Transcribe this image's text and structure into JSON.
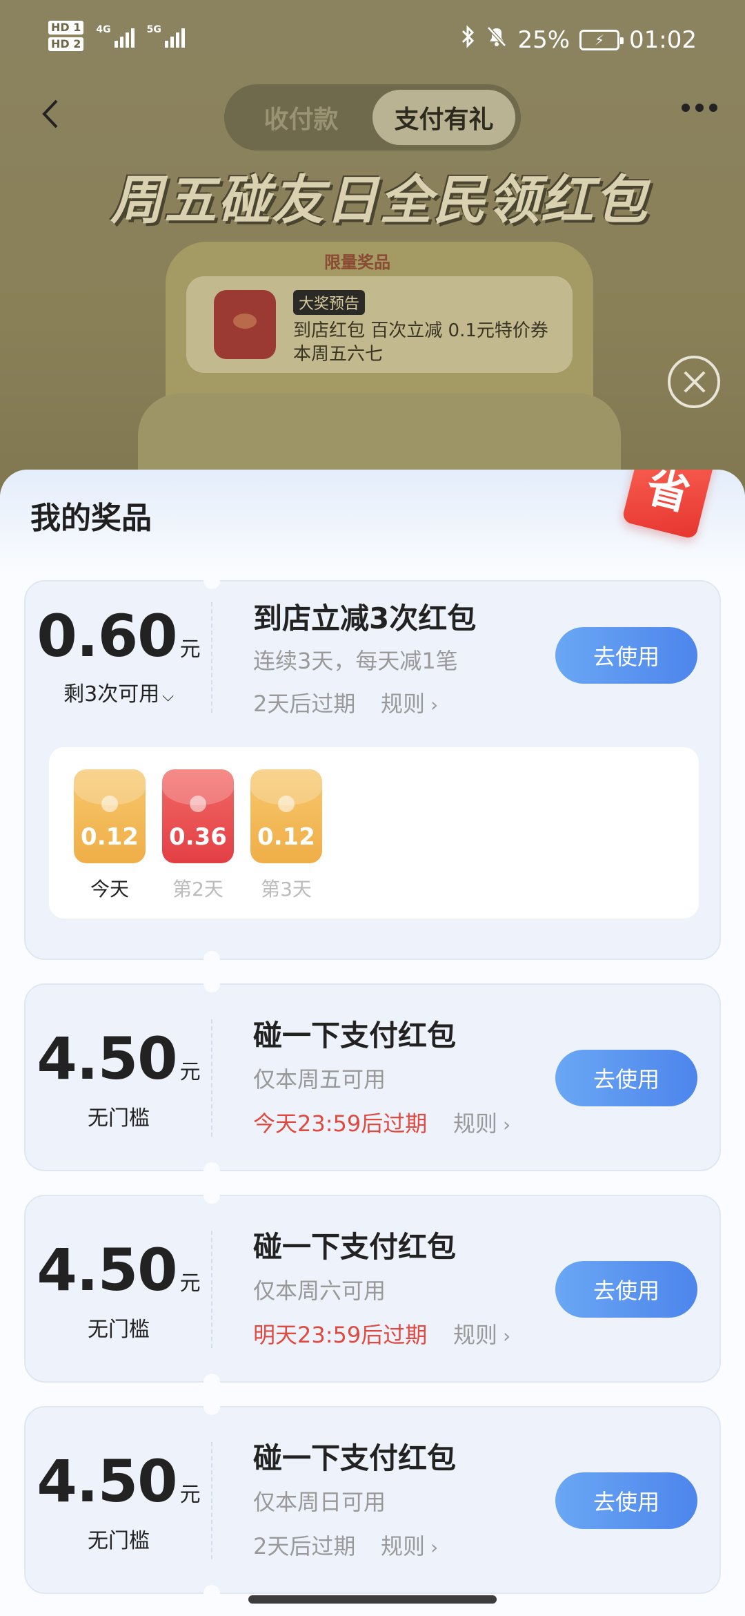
{
  "status_bar": {
    "hd1": "HD 1",
    "hd2": "HD 2",
    "net1": "4G",
    "net2": "5G",
    "battery_pct": "25%",
    "time": "01:02"
  },
  "nav": {
    "tabs": [
      {
        "label": "收付款",
        "active": false
      },
      {
        "label": "支付有礼",
        "active": true
      }
    ]
  },
  "banner": {
    "title": "周五碰友日全民领红包",
    "limit_tag": "限量奖品",
    "badge": "大奖预告",
    "prize_line1": "到店红包 百次立减 0.1元特价券",
    "prize_line2": "本周五六七"
  },
  "sheet": {
    "title": "我的奖品",
    "tag": "省"
  },
  "cards": [
    {
      "amount": "0.60",
      "unit": "元",
      "note": "剩3次可用",
      "title": "到店立减3次红包",
      "desc": "连续3天，每天减1笔",
      "expire": "2天后过期",
      "rule": "规则",
      "button": "去使用",
      "days": [
        {
          "value": "0.12",
          "label": "今天",
          "color": "gold"
        },
        {
          "value": "0.36",
          "label": "第2天",
          "color": "red"
        },
        {
          "value": "0.12",
          "label": "第3天",
          "color": "gold"
        }
      ]
    },
    {
      "amount": "4.50",
      "unit": "元",
      "note": "无门槛",
      "title": "碰一下支付红包",
      "desc": "仅本周五可用",
      "expire": "今天23:59后过期",
      "expire_red": true,
      "rule": "规则",
      "button": "去使用"
    },
    {
      "amount": "4.50",
      "unit": "元",
      "note": "无门槛",
      "title": "碰一下支付红包",
      "desc": "仅本周六可用",
      "expire": "明天23:59后过期",
      "expire_red": true,
      "rule": "规则",
      "button": "去使用"
    },
    {
      "amount": "4.50",
      "unit": "元",
      "note": "无门槛",
      "title": "碰一下支付红包",
      "desc": "仅本周日可用",
      "expire": "2天后过期",
      "expire_red": false,
      "rule": "规则",
      "button": "去使用"
    }
  ],
  "colors": {
    "accent_blue": "#4d85ec",
    "expire_red": "#e0493f",
    "packet_gold": "#efae47",
    "packet_red": "#e23f44"
  }
}
